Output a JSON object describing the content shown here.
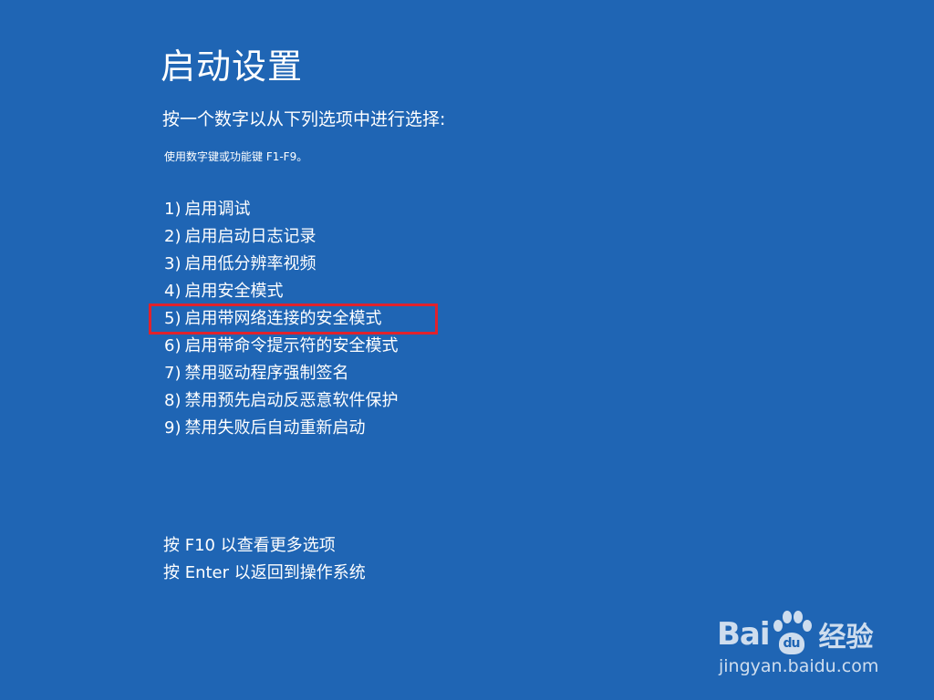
{
  "screen": {
    "title": "启动设置",
    "subtitle": "按一个数字以从下列选项中进行选择:",
    "hint": "使用数字键或功能键 F1-F9。",
    "options": [
      {
        "num": "1)",
        "label": "启用调试"
      },
      {
        "num": "2)",
        "label": "启用启动日志记录"
      },
      {
        "num": "3)",
        "label": "启用低分辨率视频"
      },
      {
        "num": "4)",
        "label": "启用安全模式"
      },
      {
        "num": "5)",
        "label": "启用带网络连接的安全模式"
      },
      {
        "num": "6)",
        "label": "启用带命令提示符的安全模式"
      },
      {
        "num": "7)",
        "label": "禁用驱动程序强制签名"
      },
      {
        "num": "8)",
        "label": "禁用预先启动反恶意软件保护"
      },
      {
        "num": "9)",
        "label": "禁用失败后自动重新启动"
      }
    ],
    "highlighted_option": "5)",
    "footer_more": "按 F10 以查看更多选项",
    "footer_return": "按 Enter 以返回到操作系统"
  },
  "watermark": {
    "brand_left": "Bai",
    "brand_paw": "du",
    "brand_cn": "经验",
    "url": "jingyan.baidu.com"
  },
  "colors": {
    "background": "#1f65b4",
    "text": "#ffffff",
    "highlight_border": "#e0222c"
  }
}
